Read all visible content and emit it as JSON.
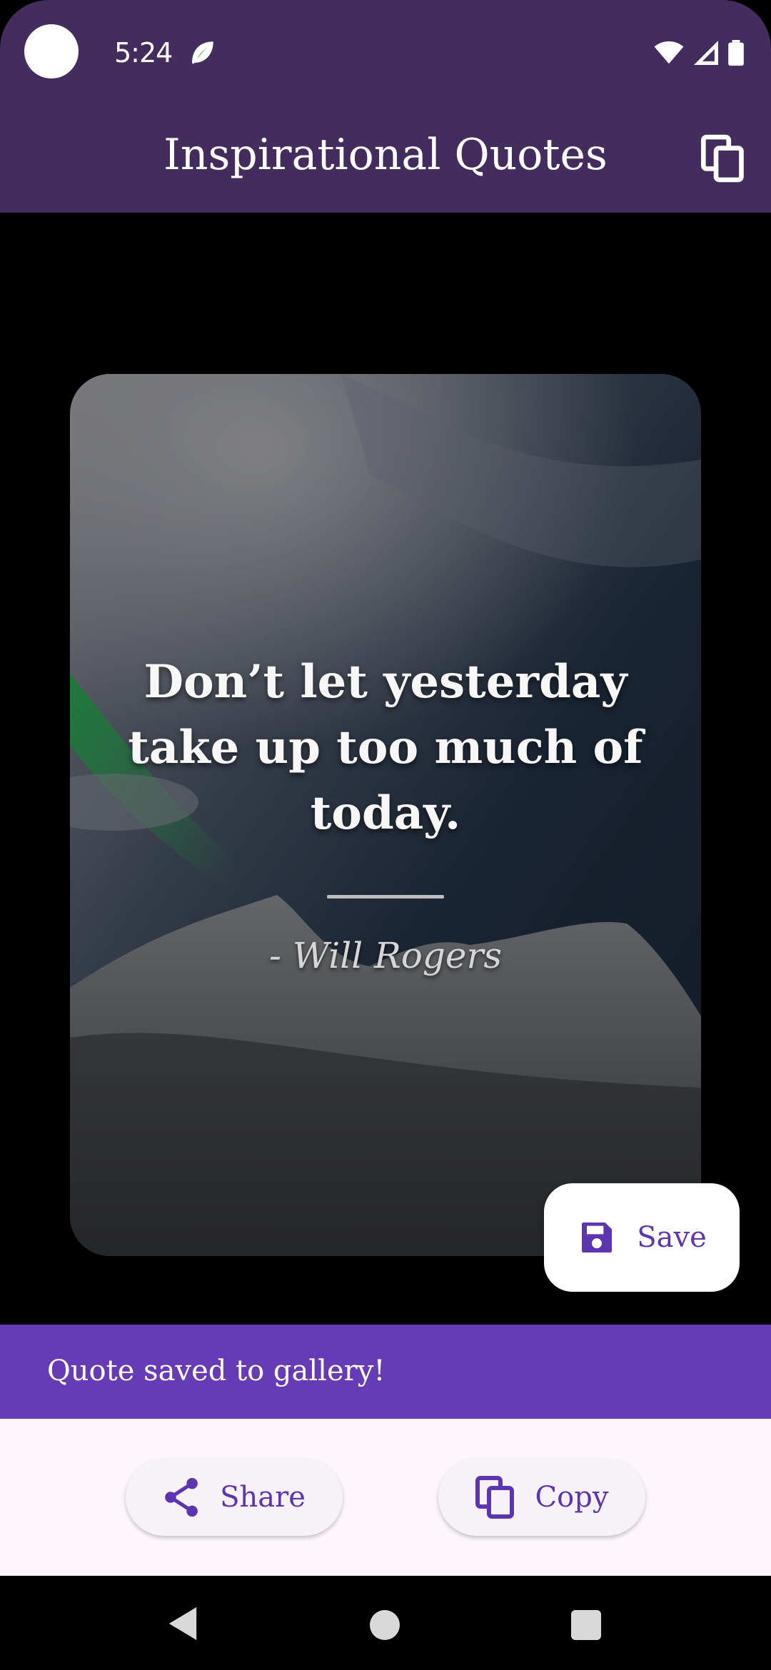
{
  "status_bar": {
    "time": "5:24",
    "icons": [
      "leaf-icon",
      "wifi-icon",
      "signal-icon",
      "battery-icon"
    ]
  },
  "app_bar": {
    "title": "Inspirational Quotes",
    "action_icon": "copy-icon"
  },
  "quote_card": {
    "quote": "Don’t let yesterday take up too much of today.",
    "author": "- Will Rogers",
    "background": "aurora-mountain-night-photo"
  },
  "save_button": {
    "label": "Save",
    "icon": "save-icon"
  },
  "snackbar": {
    "message": "Quote saved to gallery!"
  },
  "actions": {
    "share_label": "Share",
    "share_icon": "share-icon",
    "copy_label": "Copy",
    "copy_icon": "copy-icon"
  },
  "colors": {
    "app_bar": "#432c5e",
    "accent": "#673ab7",
    "button_text": "#5e35b1"
  }
}
